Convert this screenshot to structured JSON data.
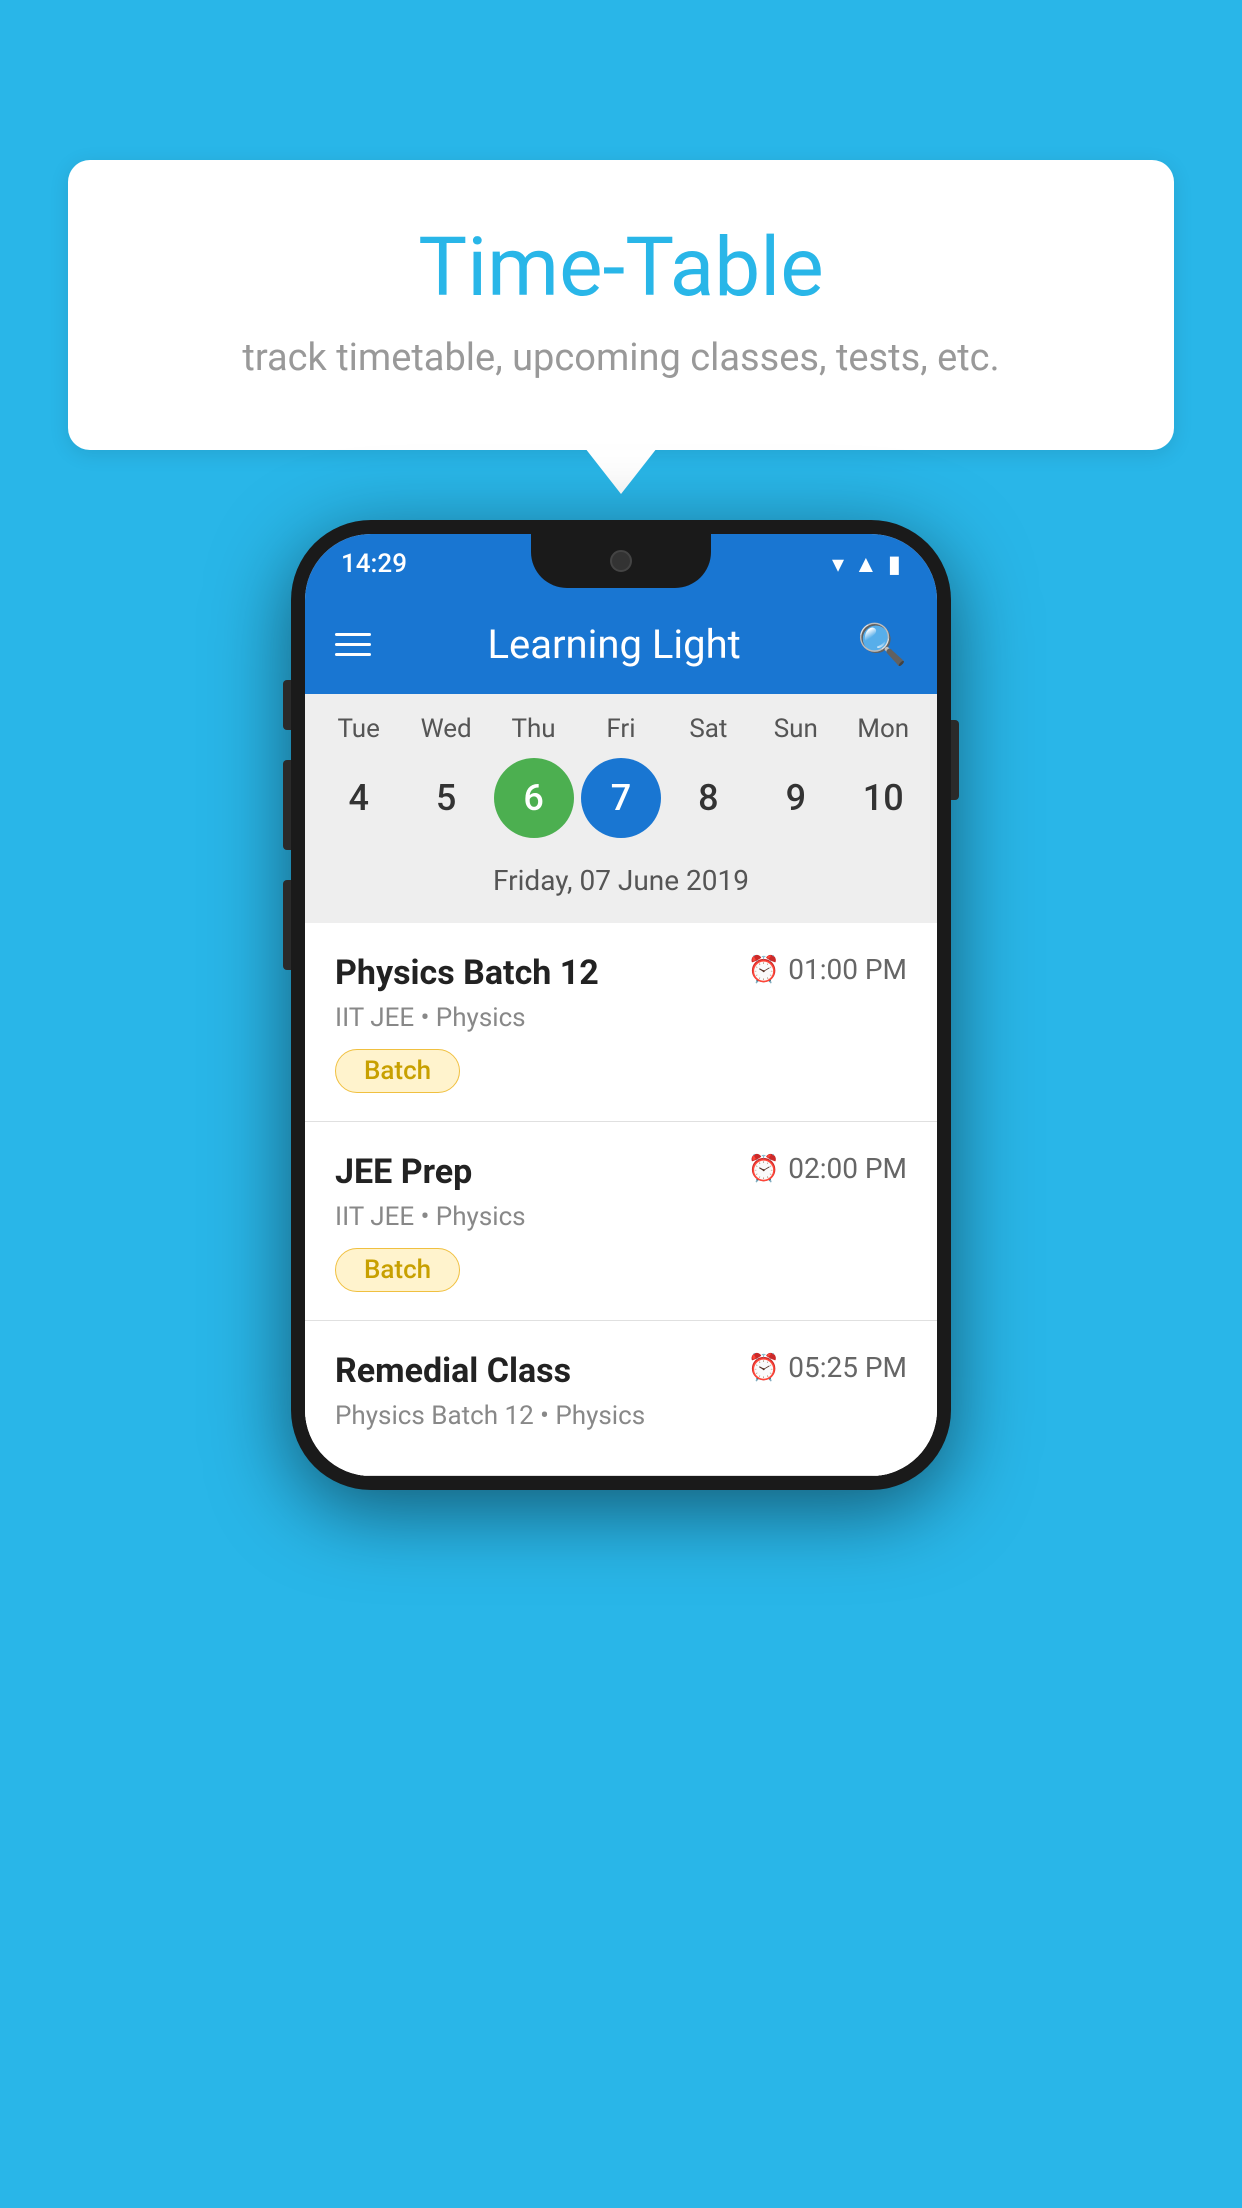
{
  "background_color": "#29b6e8",
  "tooltip": {
    "title": "Time-Table",
    "subtitle": "track timetable, upcoming classes, tests, etc."
  },
  "phone": {
    "status_bar": {
      "time": "14:29"
    },
    "app_bar": {
      "title": "Learning Light"
    },
    "calendar": {
      "days": [
        {
          "label": "Tue",
          "num": "4",
          "state": "normal"
        },
        {
          "label": "Wed",
          "num": "5",
          "state": "normal"
        },
        {
          "label": "Thu",
          "num": "6",
          "state": "today"
        },
        {
          "label": "Fri",
          "num": "7",
          "state": "selected"
        },
        {
          "label": "Sat",
          "num": "8",
          "state": "normal"
        },
        {
          "label": "Sun",
          "num": "9",
          "state": "normal"
        },
        {
          "label": "Mon",
          "num": "10",
          "state": "normal"
        }
      ],
      "selected_date_label": "Friday, 07 June 2019"
    },
    "schedule": [
      {
        "name": "Physics Batch 12",
        "time": "01:00 PM",
        "meta": "IIT JEE • Physics",
        "badge": "Batch"
      },
      {
        "name": "JEE Prep",
        "time": "02:00 PM",
        "meta": "IIT JEE • Physics",
        "badge": "Batch"
      },
      {
        "name": "Remedial Class",
        "time": "05:25 PM",
        "meta": "Physics Batch 12 • Physics",
        "badge": null
      }
    ]
  }
}
